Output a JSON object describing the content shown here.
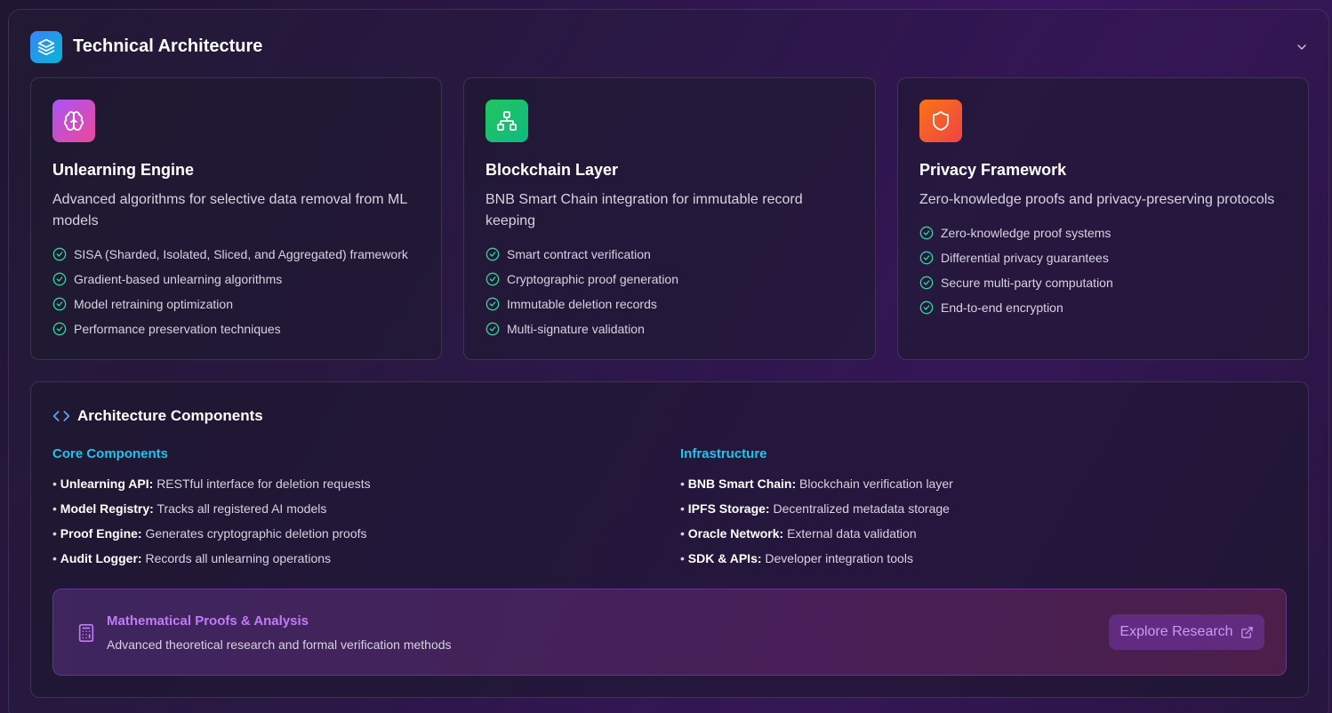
{
  "header": {
    "title": "Technical Architecture",
    "icon": "layers-icon",
    "collapse_icon": "chevron-down-icon"
  },
  "cards": [
    {
      "icon": "brain-icon",
      "icon_gradient": [
        "#a855f7",
        "#ec4899"
      ],
      "title": "Unlearning Engine",
      "description": "Advanced algorithms for selective data removal from ML models",
      "features": [
        "SISA (Sharded, Isolated, Sliced, and Aggregated) framework",
        "Gradient-based unlearning algorithms",
        "Model retraining optimization",
        "Performance preservation techniques"
      ]
    },
    {
      "icon": "network-icon",
      "icon_gradient": [
        "#22c55e",
        "#10b981"
      ],
      "title": "Blockchain Layer",
      "description": "BNB Smart Chain integration for immutable record keeping",
      "features": [
        "Smart contract verification",
        "Cryptographic proof generation",
        "Immutable deletion records",
        "Multi-signature validation"
      ]
    },
    {
      "icon": "shield-icon",
      "icon_gradient": [
        "#f97316",
        "#ef4444"
      ],
      "title": "Privacy Framework",
      "description": "Zero-knowledge proofs and privacy-preserving protocols",
      "features": [
        "Zero-knowledge proof systems",
        "Differential privacy guarantees",
        "Secure multi-party computation",
        "End-to-end encryption"
      ]
    }
  ],
  "architecture": {
    "title": "Architecture Components",
    "icon": "code-icon",
    "core": {
      "title": "Core Components",
      "items": [
        {
          "name": "Unlearning API:",
          "desc": "RESTful interface for deletion requests"
        },
        {
          "name": "Model Registry:",
          "desc": "Tracks all registered AI models"
        },
        {
          "name": "Proof Engine:",
          "desc": "Generates cryptographic deletion proofs"
        },
        {
          "name": "Audit Logger:",
          "desc": "Records all unlearning operations"
        }
      ]
    },
    "infra": {
      "title": "Infrastructure",
      "items": [
        {
          "name": "BNB Smart Chain:",
          "desc": "Blockchain verification layer"
        },
        {
          "name": "IPFS Storage:",
          "desc": "Decentralized metadata storage"
        },
        {
          "name": "Oracle Network:",
          "desc": "External data validation"
        },
        {
          "name": "SDK & APIs:",
          "desc": "Developer integration tools"
        }
      ]
    },
    "research": {
      "icon": "calculator-icon",
      "title": "Mathematical Proofs & Analysis",
      "description": "Advanced theoretical research and formal verification methods",
      "button_label": "Explore Research",
      "button_icon": "external-link-icon"
    }
  },
  "colors": {
    "check": "#34d399",
    "section_heading": "#22c3e6",
    "research_title": "#c27bf7"
  }
}
